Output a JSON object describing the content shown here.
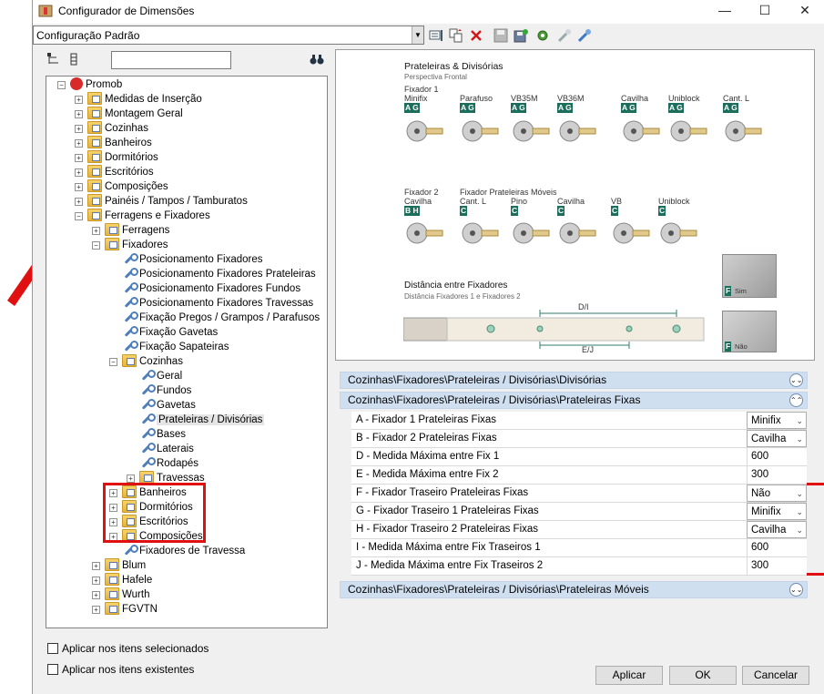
{
  "window": {
    "title": "Configurador de Dimensões",
    "controls": {
      "minimize": "—",
      "maximize": "☐",
      "close": "✕"
    }
  },
  "toolbar": {
    "config_combo_value": "Configuração Padrão",
    "icons": [
      "properties-icon",
      "copy-config-icon",
      "delete-icon",
      "save-icon",
      "save-as-icon",
      "settings-icon",
      "import-icon",
      "export-icon"
    ]
  },
  "tree": {
    "root": "Promob",
    "items": [
      {
        "label": "Medidas de Inserção"
      },
      {
        "label": "Montagem Geral"
      },
      {
        "label": "Cozinhas"
      },
      {
        "label": "Banheiros"
      },
      {
        "label": "Dormitórios"
      },
      {
        "label": "Escritórios"
      },
      {
        "label": "Composições"
      },
      {
        "label": "Painéis / Tampos / Tamburatos"
      },
      {
        "label": "Ferragens e Fixadores"
      },
      {
        "label": "Ferragens"
      },
      {
        "label": "Fixadores"
      },
      {
        "label": "Posicionamento Fixadores"
      },
      {
        "label": "Posicionamento Fixadores Prateleiras"
      },
      {
        "label": "Posicionamento Fixadores Fundos"
      },
      {
        "label": "Posicionamento Fixadores Travessas"
      },
      {
        "label": "Fixação Pregos / Grampos / Parafusos"
      },
      {
        "label": "Fixação Gavetas"
      },
      {
        "label": "Fixação Sapateiras"
      },
      {
        "label": "Cozinhas"
      },
      {
        "label": "Geral"
      },
      {
        "label": "Fundos"
      },
      {
        "label": "Gavetas"
      },
      {
        "label": "Prateleiras / Divisórias"
      },
      {
        "label": "Bases"
      },
      {
        "label": "Laterais"
      },
      {
        "label": "Rodapés"
      },
      {
        "label": "Travessas"
      },
      {
        "label": "Banheiros"
      },
      {
        "label": "Dormitórios"
      },
      {
        "label": "Escritórios"
      },
      {
        "label": "Composições"
      },
      {
        "label": "Fixadores de Travessa"
      },
      {
        "label": "Blum"
      },
      {
        "label": "Hafele"
      },
      {
        "label": "Wurth"
      },
      {
        "label": "FGVTN"
      }
    ]
  },
  "illustration": {
    "title": "Prateleiras & Divisórias",
    "subtitle": "Perspectiva Frontal",
    "row1_label": "Fixador 1",
    "row1_items": [
      {
        "name": "Minifix",
        "tag": "A G"
      },
      {
        "name": "Parafuso",
        "tag": "A G"
      },
      {
        "name": "VB35M",
        "tag": "A G"
      },
      {
        "name": "VB36M",
        "tag": "A G"
      },
      {
        "name": "Cavilha",
        "tag": "A G"
      },
      {
        "name": "Uniblock",
        "tag": "A G"
      },
      {
        "name": "Cant. L",
        "tag": "A G"
      }
    ],
    "row2_label": "Fixador 2",
    "row2_group_label": "Fixador Prateleiras Móveis",
    "row2_items": [
      {
        "name": "Cavilha",
        "tag": "B H"
      },
      {
        "name": "Cant. L",
        "tag": "C"
      },
      {
        "name": "Pino",
        "tag": "C"
      },
      {
        "name": "Cavilha",
        "tag": "C"
      },
      {
        "name": "VB",
        "tag": "C"
      },
      {
        "name": "Uniblock",
        "tag": "C"
      }
    ],
    "distance_title": "Distância entre Fixadores",
    "distance_subtitle": "Distância Fixadores 1 e Fixadores 2",
    "dim_top": "D/I",
    "dim_bottom": "E/J",
    "side_tag": "F",
    "side_sim": "Sim",
    "side_nao": "Não"
  },
  "property_grid": {
    "section1": "Cozinhas\\Fixadores\\Prateleiras / Divisórias\\Divisórias",
    "section2": "Cozinhas\\Fixadores\\Prateleiras / Divisórias\\Prateleiras Fixas",
    "section3": "Cozinhas\\Fixadores\\Prateleiras / Divisórias\\Prateleiras Móveis",
    "rows": [
      {
        "label": "A - Fixador 1 Prateleiras Fixas",
        "value": "Minifix"
      },
      {
        "label": "B - Fixador 2 Prateleiras Fixas",
        "value": "Cavilha"
      },
      {
        "label": "D - Medida Máxima entre Fix 1",
        "value": "600"
      },
      {
        "label": "E - Medida Máxima entre Fix 2",
        "value": "300"
      },
      {
        "label": "F - Fixador Traseiro Prateleiras Fixas",
        "value": "Não"
      },
      {
        "label": "G - Fixador Traseiro 1 Prateleiras Fixas",
        "value": "Minifix"
      },
      {
        "label": "H - Fixador Traseiro 2 Prateleiras Fixas",
        "value": "Cavilha"
      },
      {
        "label": "I - Medida Máxima entre Fix Traseiros 1",
        "value": "600"
      },
      {
        "label": "J - Medida Máxima entre Fix Traseiros 2",
        "value": "300"
      }
    ]
  },
  "options": {
    "apply_selected": "Aplicar nos itens selecionados",
    "apply_existing": "Aplicar nos itens existentes"
  },
  "buttons": {
    "apply": "Aplicar",
    "ok": "OK",
    "cancel": "Cancelar"
  },
  "colors": {
    "annotation_red": "#e01010",
    "section_header": "#cfdff0",
    "tag_green": "#1c6e5c"
  }
}
